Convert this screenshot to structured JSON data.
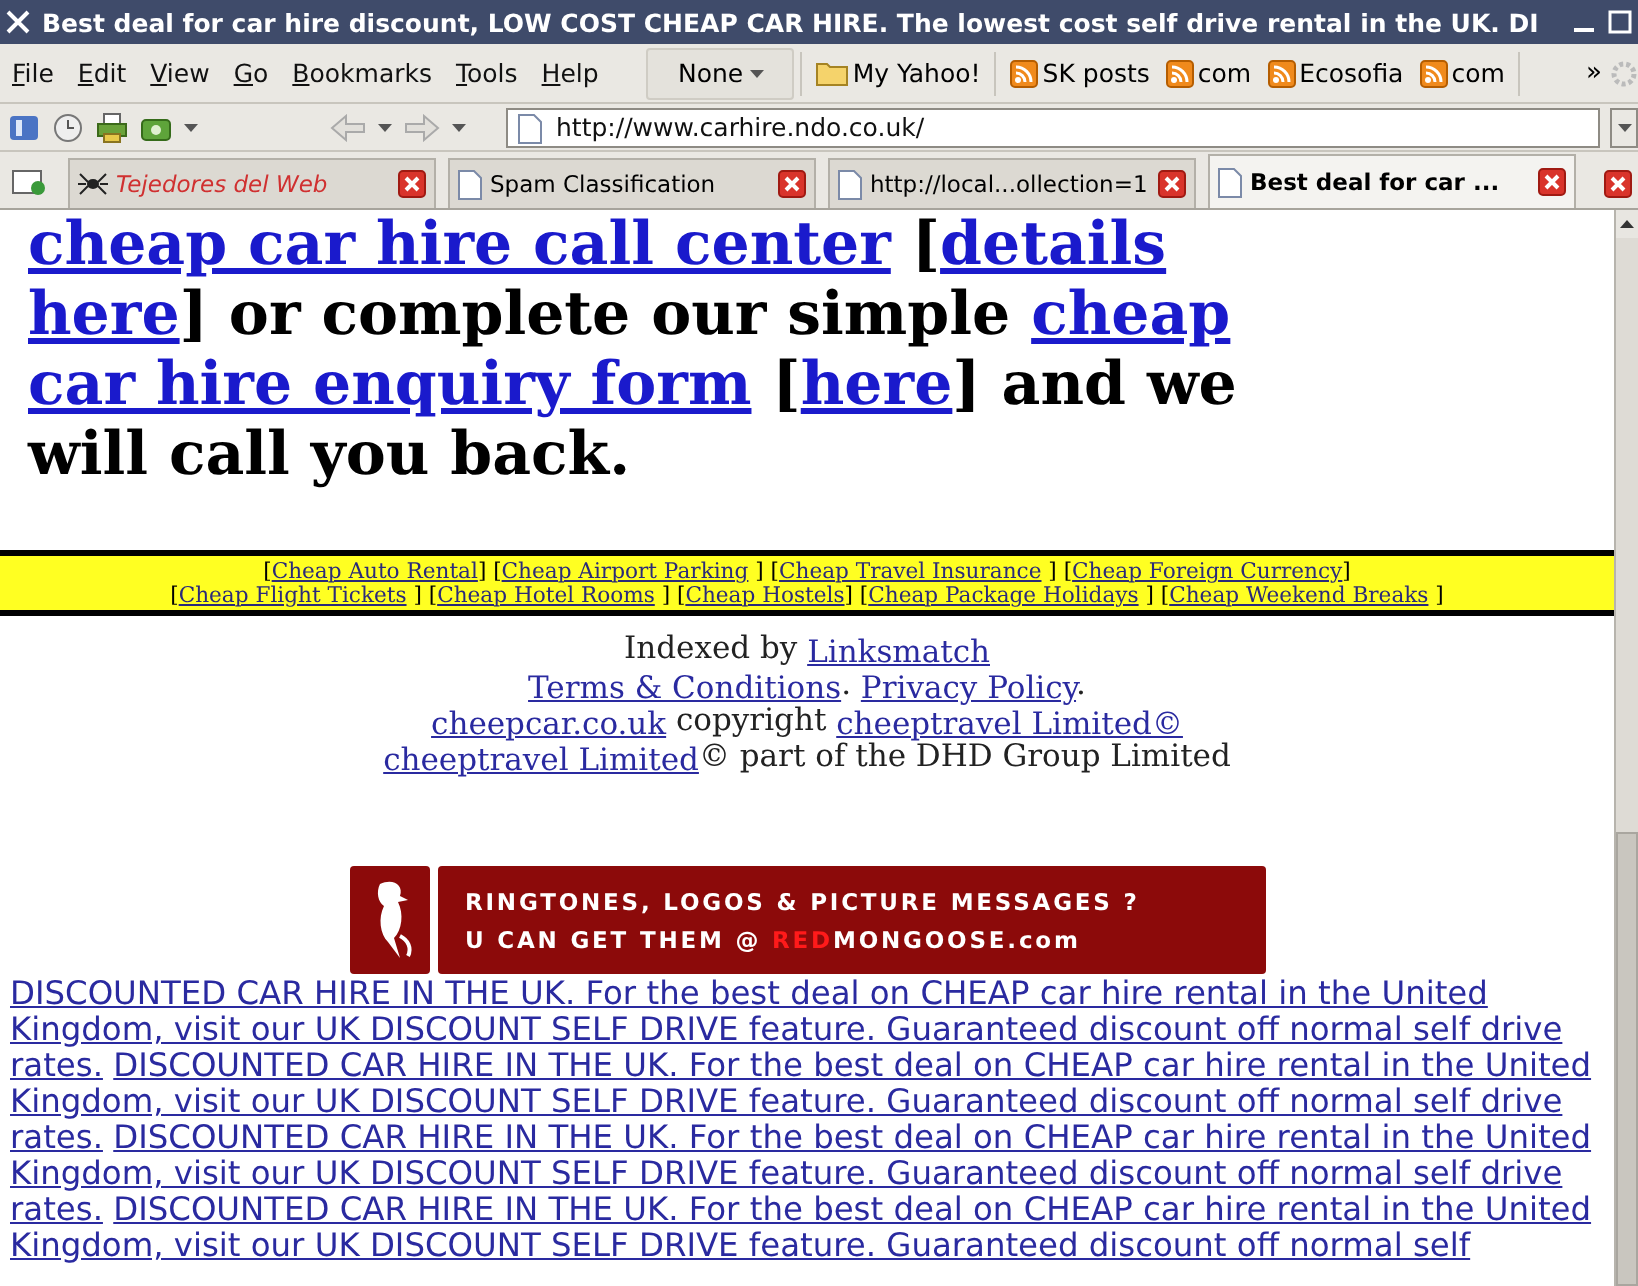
{
  "window": {
    "title": "Best deal for car hire discount, LOW COST CHEAP CAR HIRE. The lowest cost self drive rental in the UK. DI"
  },
  "menu": [
    "File",
    "Edit",
    "View",
    "Go",
    "Bookmarks",
    "Tools",
    "Help"
  ],
  "bookmarks_toolbar": {
    "folder_menu": "None",
    "items": [
      {
        "label": "My Yahoo!",
        "kind": "folder"
      },
      {
        "label": "SK posts",
        "kind": "feed"
      },
      {
        "label": "com",
        "kind": "feed"
      },
      {
        "label": "Ecosofia",
        "kind": "feed"
      },
      {
        "label": "com",
        "kind": "feed"
      }
    ],
    "overflow": "»"
  },
  "address_bar": {
    "value": "http://www.carhire.ndo.co.uk/"
  },
  "tabs": [
    {
      "label": "Tejedores del Web",
      "selected": false,
      "kind": "styled"
    },
    {
      "label": "Spam Classification",
      "selected": false,
      "kind": "page"
    },
    {
      "label": "http://local...ollection=1",
      "selected": false,
      "kind": "page"
    },
    {
      "label": "Best deal for car ...",
      "selected": true,
      "kind": "page"
    }
  ],
  "page": {
    "headline": [
      {
        "text": "cheap car hire call center",
        "kind": "link"
      },
      {
        "text": " [",
        "kind": "text"
      },
      {
        "text": "details here",
        "kind": "link"
      },
      {
        "text": "] or complete our simple ",
        "kind": "text"
      },
      {
        "text": "cheap car hire enquiry form",
        "kind": "link"
      },
      {
        "text": " [",
        "kind": "text"
      },
      {
        "text": "here",
        "kind": "link"
      },
      {
        "text": "] and we will call you back.",
        "kind": "text"
      }
    ],
    "link_bar": [
      [
        {
          "text": "[",
          "kind": "text"
        },
        {
          "text": "Cheap Auto Rental",
          "kind": "link"
        },
        {
          "text": "] [",
          "kind": "text"
        },
        {
          "text": "Cheap Airport Parking",
          "kind": "link"
        },
        {
          "text": " ] [",
          "kind": "text"
        },
        {
          "text": "Cheap Travel Insurance",
          "kind": "link"
        },
        {
          "text": " ] [",
          "kind": "text"
        },
        {
          "text": "Cheap Foreign Currency",
          "kind": "link"
        },
        {
          "text": "]",
          "kind": "text"
        }
      ],
      [
        {
          "text": "[",
          "kind": "text"
        },
        {
          "text": "Cheap Flight Tickets",
          "kind": "link"
        },
        {
          "text": " ] [",
          "kind": "text"
        },
        {
          "text": "Cheap Hotel Rooms",
          "kind": "link"
        },
        {
          "text": " ] [",
          "kind": "text"
        },
        {
          "text": "Cheap Hostels",
          "kind": "link"
        },
        {
          "text": "] [",
          "kind": "text"
        },
        {
          "text": "Cheap Package Holidays",
          "kind": "link"
        },
        {
          "text": " ] [",
          "kind": "text"
        },
        {
          "text": "Cheap Weekend Breaks",
          "kind": "link"
        },
        {
          "text": " ]",
          "kind": "text"
        }
      ]
    ],
    "footer": [
      [
        {
          "text": "Indexed by ",
          "kind": "text"
        },
        {
          "text": "Linksmatch",
          "kind": "link"
        }
      ],
      [
        {
          "text": "Terms & Conditions",
          "kind": "link"
        },
        {
          "text": ". ",
          "kind": "text"
        },
        {
          "text": "Privacy Policy",
          "kind": "link"
        },
        {
          "text": ".",
          "kind": "text"
        }
      ],
      [
        {
          "text": "cheepcar.co.uk",
          "kind": "link"
        },
        {
          "text": " copyright ",
          "kind": "text"
        },
        {
          "text": "cheeptravel Limited©",
          "kind": "link"
        }
      ],
      [
        {
          "text": "cheeptravel Limited",
          "kind": "link"
        },
        {
          "text": "© part of the DHD Group Limited",
          "kind": "text"
        }
      ]
    ],
    "banner": {
      "line1": "RINGTONES, LOGOS & PICTURE MESSAGES ?",
      "line2": "U CAN GET THEM @ ",
      "brand_highlight": "RED",
      "brand_rest": "MONGOOSE.com"
    },
    "promo_links": [
      "DISCOUNTED CAR HIRE IN THE UK. For the best deal on CHEAP car hire rental in the United Kingdom, visit our UK DISCOUNT SELF DRIVE feature. Guaranteed discount off normal self drive rates.",
      "DISCOUNTED CAR HIRE IN THE UK. For the best deal on CHEAP car hire rental in the United Kingdom, visit our UK DISCOUNT SELF DRIVE feature. Guaranteed discount off normal self drive rates.",
      "DISCOUNTED CAR HIRE IN THE UK. For the best deal on CHEAP car hire rental in the United Kingdom, visit our UK DISCOUNT SELF DRIVE feature. Guaranteed discount off normal self drive rates.",
      "DISCOUNTED CAR HIRE IN THE UK. For the best deal on CHEAP car hire rental in the United Kingdom, visit our UK DISCOUNT SELF DRIVE feature. Guaranteed discount off normal self"
    ]
  }
}
